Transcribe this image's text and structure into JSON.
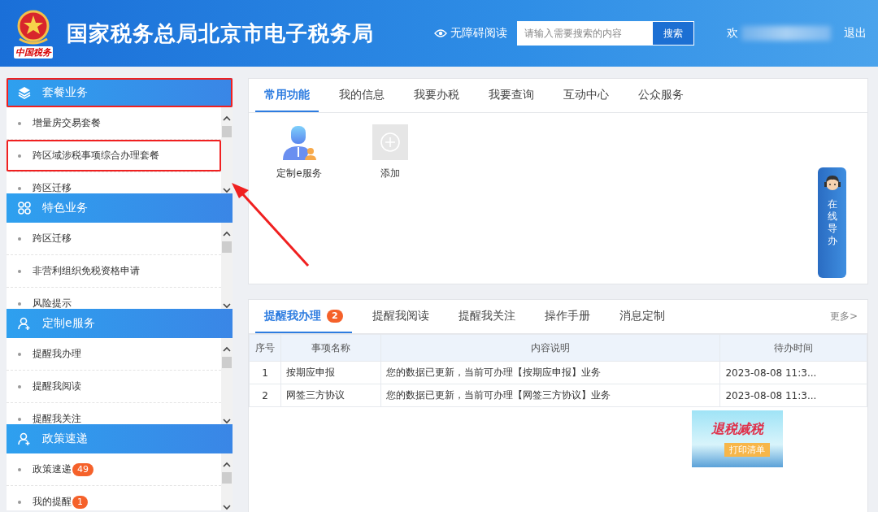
{
  "header": {
    "logo_text": "中国税务",
    "title": "国家税务总局北京市电子税务局",
    "accessibility_link": "无障碍阅读",
    "search": {
      "placeholder": "请输入需要搜索的内容",
      "button": "搜索"
    },
    "welcome": "欢",
    "logout": "退出"
  },
  "sidebar": {
    "sections": [
      {
        "title": "套餐业务",
        "kind": "layers",
        "highlighted": true,
        "items": [
          {
            "label": "增量房交易套餐",
            "highlighted": false
          },
          {
            "label": "跨区域涉税事项综合办理套餐",
            "highlighted": true
          },
          {
            "label": "跨区迁移",
            "highlighted": false
          }
        ]
      },
      {
        "title": "特色业务",
        "kind": "grid",
        "highlighted": false,
        "items": [
          {
            "label": "跨区迁移",
            "highlighted": false
          },
          {
            "label": "非营利组织免税资格申请",
            "highlighted": false
          },
          {
            "label": "风险提示",
            "highlighted": false
          }
        ]
      },
      {
        "title": "定制e服务",
        "kind": "user-add",
        "highlighted": false,
        "items": [
          {
            "label": "提醒我办理",
            "highlighted": false
          },
          {
            "label": "提醒我阅读",
            "highlighted": false
          },
          {
            "label": "提醒我关注",
            "highlighted": false
          }
        ]
      },
      {
        "title": "政策速递",
        "kind": "user-add",
        "highlighted": false,
        "items": [
          {
            "label": "政策速递",
            "badge": "49",
            "highlighted": false
          },
          {
            "label": "我的提醒",
            "badge": "1",
            "highlighted": false
          }
        ]
      }
    ]
  },
  "functions": {
    "tabs": [
      {
        "label": "常用功能",
        "selected": true
      },
      {
        "label": "我的信息",
        "selected": false
      },
      {
        "label": "我要办税",
        "selected": false
      },
      {
        "label": "我要查询",
        "selected": false
      },
      {
        "label": "互动中心",
        "selected": false
      },
      {
        "label": "公众服务",
        "selected": false
      }
    ],
    "shortcuts": [
      {
        "kind": "person",
        "label": "定制e服务"
      },
      {
        "kind": "add",
        "label": "添加"
      }
    ]
  },
  "chat_widget": {
    "label": "在线导办"
  },
  "reminders": {
    "tabs": [
      {
        "label": "提醒我办理",
        "badge": "2",
        "selected": true
      },
      {
        "label": "提醒我阅读",
        "selected": false
      },
      {
        "label": "提醒我关注",
        "selected": false
      },
      {
        "label": "操作手册",
        "selected": false
      },
      {
        "label": "消息定制",
        "selected": false
      }
    ],
    "more": "更多>",
    "table": {
      "columns": [
        "序号",
        "事项名称",
        "内容说明",
        "待办时间"
      ],
      "rows": [
        [
          "1",
          "按期应申报",
          "您的数据已更新，当前可办理【按期应申报】业务",
          "2023-08-08 11:3..."
        ],
        [
          "2",
          "网签三方协议",
          "您的数据已更新，当前可办理【网签三方协议】业务",
          "2023-08-08 11:3..."
        ]
      ]
    }
  },
  "banner": {
    "title": "退税减税",
    "button": "打印清单"
  },
  "pointer_arrow": true
}
